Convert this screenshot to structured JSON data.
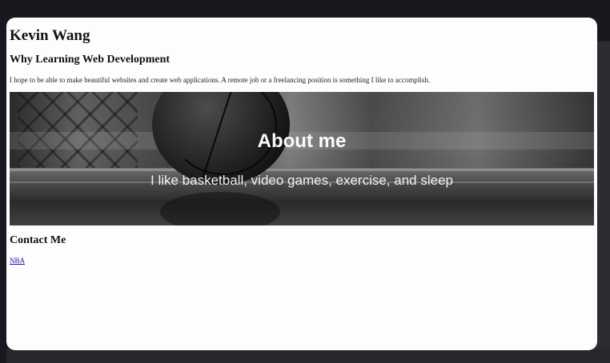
{
  "page": {
    "heading": "Kevin Wang",
    "why_heading": "Why Learning Web Development",
    "why_text": "I hope to be able to make beautiful websites and create web applications. A remote job or a freelancing position is something I like to accomplish.",
    "hero": {
      "title": "About me",
      "subtitle": "I like basketball, video games, exercise, and sleep",
      "image": "basketball-photo"
    },
    "contact_heading": "Contact Me",
    "contact_link": "NBA"
  },
  "colors": {
    "page_background": "#fdfdfd",
    "app_background": "#17191e",
    "link": "#1a0dab"
  }
}
